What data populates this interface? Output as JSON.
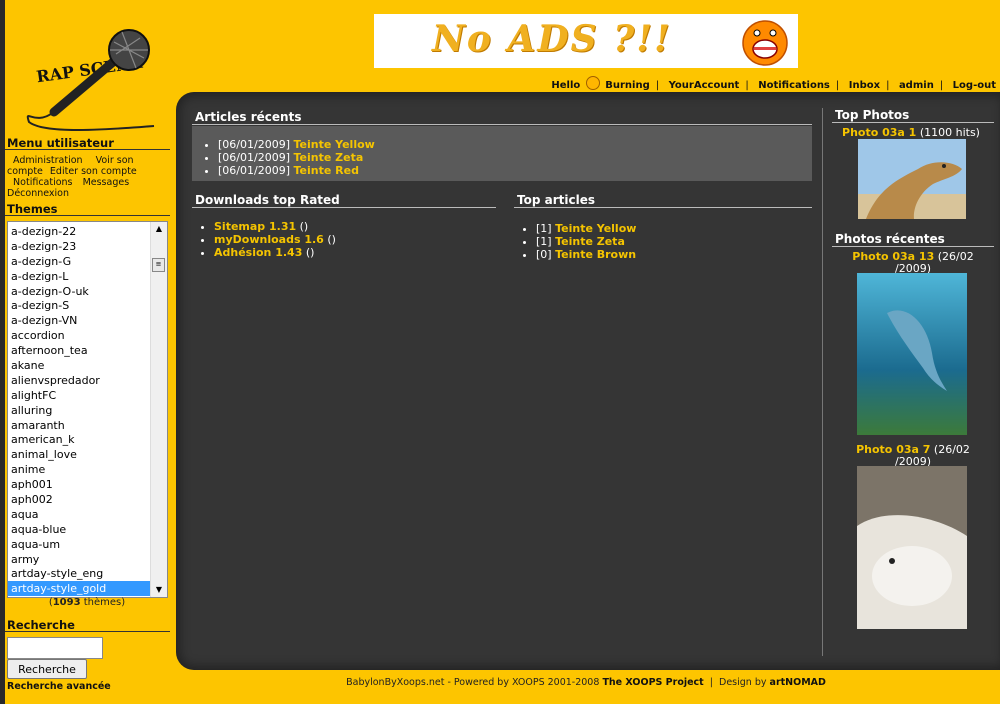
{
  "header": {
    "logo_text": "RAP SCENA",
    "banner_text": "No ADS ?!!",
    "user_greeting": "Hello",
    "username": "Burning",
    "nav": [
      "YourAccount",
      "Notifications",
      "Inbox",
      "admin",
      "Log-out"
    ]
  },
  "sidebar": {
    "user_menu_title": "Menu utilisateur",
    "user_menu_links": [
      "Administration",
      "Voir son compte",
      "Editer son compte",
      "Notifications",
      "Messages",
      "Déconnexion"
    ],
    "themes_title": "Themes",
    "themes": [
      "a-dezign-22",
      "a-dezign-23",
      "a-dezign-G",
      "a-dezign-L",
      "a-dezign-O-uk",
      "a-dezign-S",
      "a-dezign-VN",
      "accordion",
      "afternoon_tea",
      "akane",
      "alienvspredador",
      "alightFC",
      "alluring",
      "amaranth",
      "american_k",
      "animal_love",
      "anime",
      "aph001",
      "aph002",
      "aqua",
      "aqua-blue",
      "aqua-um",
      "army",
      "artday-style_eng",
      "artday-style_gold"
    ],
    "themes_selected": "artday-style_gold",
    "themes_count": "1093",
    "themes_count_suffix": "thèmes",
    "search_title": "Recherche",
    "search_value": "",
    "search_button": "Recherche",
    "advanced_search": "Recherche avancée"
  },
  "main": {
    "recent_articles": {
      "title": "Articles récents",
      "items": [
        {
          "date": "[06/01/2009]",
          "title": "Teinte Yellow"
        },
        {
          "date": "[06/01/2009]",
          "title": "Teinte Zeta"
        },
        {
          "date": "[06/01/2009]",
          "title": "Teinte Red"
        }
      ]
    },
    "downloads": {
      "title": "Downloads top Rated",
      "items": [
        {
          "title": "Sitemap 1.31",
          "suffix": "()"
        },
        {
          "title": "myDownloads 1.6",
          "suffix": "()"
        },
        {
          "title": "Adhésion 1.43",
          "suffix": "()"
        }
      ]
    },
    "top_articles": {
      "title": "Top articles",
      "items": [
        {
          "count": "[1]",
          "title": "Teinte Yellow"
        },
        {
          "count": "[1]",
          "title": "Teinte Zeta"
        },
        {
          "count": "[0]",
          "title": "Teinte Brown"
        }
      ]
    }
  },
  "right": {
    "top_photos_title": "Top Photos",
    "top_photo": {
      "title": "Photo 03a 1",
      "meta": "(1100 hits)",
      "icon": "camel-photo"
    },
    "recent_photos_title": "Photos récentes",
    "recent_photos": [
      {
        "title": "Photo 03a 13",
        "meta_line1": "(26/02",
        "meta_line2": "/2009)",
        "icon": "dolphin-photo"
      },
      {
        "title": "Photo 03a 7",
        "meta_line1": "(26/02",
        "meta_line2": "/2009)",
        "icon": "polar-bear-photo"
      }
    ]
  },
  "footer": {
    "site": "BabylonByXoops.net - Powered by XOOPS 2001-2008",
    "project": "The XOOPS Project",
    "design_prefix": "Design by",
    "designer": "artNOMAD"
  },
  "colors": {
    "background": "#fdc500",
    "panel": "#353535",
    "link_gold": "#f5c400",
    "selected": "#3399ff"
  }
}
